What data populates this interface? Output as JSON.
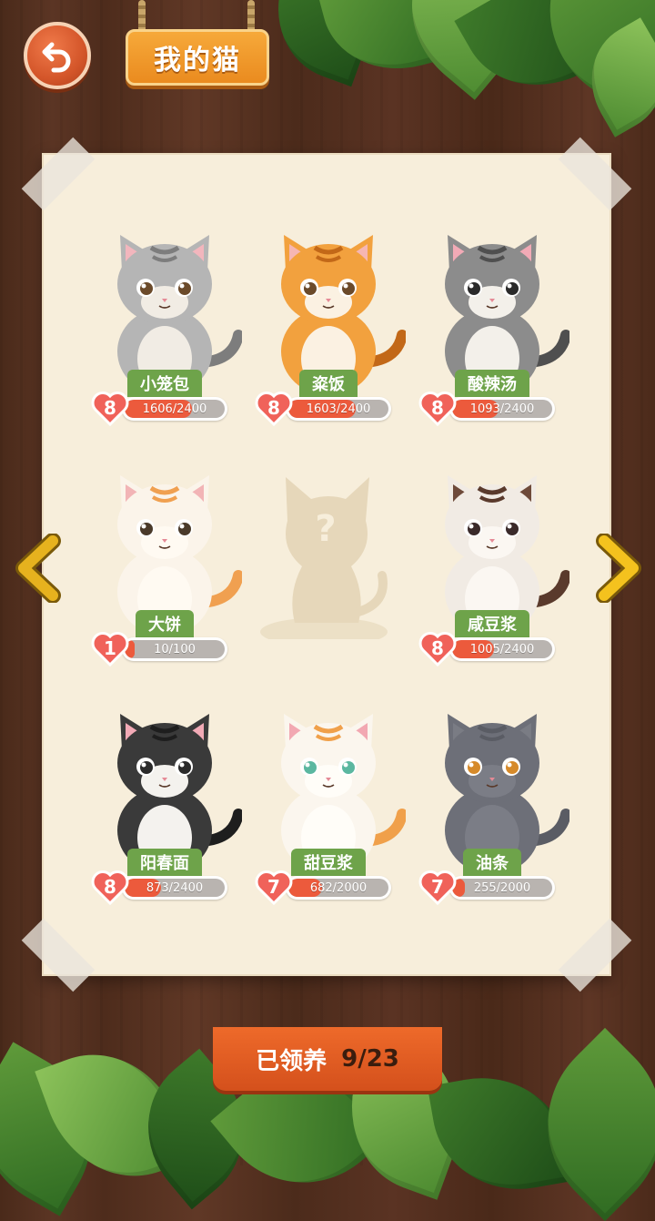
{
  "header": {
    "title": "我的猫"
  },
  "cats": [
    {
      "name": "小笼包",
      "level": "8",
      "progress_text": "1606/2400",
      "progress": 0.67,
      "fur": "#b5b5b5",
      "ear": "#f2b6bd",
      "stripe": "#7d7d7d",
      "chest": "#f1ece4",
      "eye": "#6b4a2a"
    },
    {
      "name": "粢饭",
      "level": "8",
      "progress_text": "1603/2400",
      "progress": 0.67,
      "fur": "#f2a13e",
      "ear": "#f6b6b3",
      "stripe": "#c26818",
      "chest": "#fbf1e2",
      "eye": "#6b4a2a"
    },
    {
      "name": "酸辣汤",
      "level": "8",
      "progress_text": "1093/2400",
      "progress": 0.46,
      "fur": "#8c8c8c",
      "ear": "#f2aab6",
      "stripe": "#4f4f4f",
      "chest": "#f3f0ea",
      "eye": "#2a2a2a"
    },
    {
      "name": "大饼",
      "level": "1",
      "progress_text": "10/100",
      "progress": 0.1,
      "fur": "#fbf4ea",
      "ear": "#f2b4b6",
      "stripe": "#f0a050",
      "chest": "#fffaf2",
      "eye": "#4a3a2a"
    },
    {
      "name": "",
      "level": "",
      "progress_text": "",
      "progress": 0,
      "locked": true
    },
    {
      "name": "咸豆浆",
      "level": "8",
      "progress_text": "1005/2400",
      "progress": 0.42,
      "fur": "#f1ebe4",
      "ear": "#6e4a3a",
      "stripe": "#5a3a2c",
      "chest": "#fbf7f2",
      "eye": "#3a2a2a"
    },
    {
      "name": "阳春面",
      "level": "8",
      "progress_text": "873/2400",
      "progress": 0.36,
      "fur": "#3a3a3a",
      "ear": "#f2aab6",
      "stripe": "#1e1e1e",
      "chest": "#f4f2ee",
      "eye": "#2a2a2a"
    },
    {
      "name": "甜豆浆",
      "level": "7",
      "progress_text": "682/2000",
      "progress": 0.34,
      "fur": "#fbf6ee",
      "ear": "#f2a8b2",
      "stripe": "#f0a04a",
      "chest": "#fffdf8",
      "eye": "#5bb7a0"
    },
    {
      "name": "油条",
      "level": "7",
      "progress_text": "255/2000",
      "progress": 0.13,
      "fur": "#6d6f78",
      "ear": "#7a7c84",
      "stripe": "#5a5c64",
      "chest": "#7b7d86",
      "eye": "#d68a2a"
    }
  ],
  "locked_mark": "?",
  "footer": {
    "label": "已领养",
    "count": "9/23"
  },
  "colors": {
    "accent": "#ec5a3c",
    "tag_green": "#6ea34a",
    "paper": "#f7eedb"
  },
  "icons": {
    "back": "back-arrow-icon",
    "prev": "chevron-left-icon",
    "next": "chevron-right-icon",
    "heart": "heart-icon"
  }
}
